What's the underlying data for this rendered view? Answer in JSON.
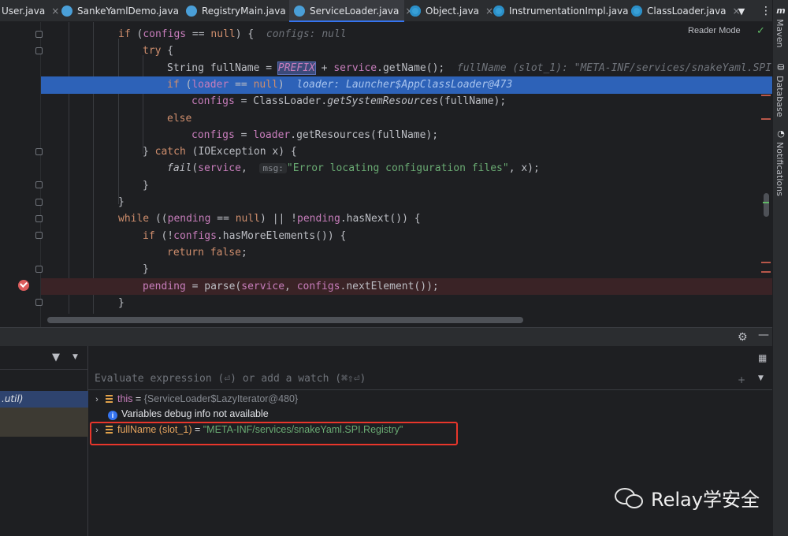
{
  "tabs": [
    {
      "label": "User.java",
      "active": false
    },
    {
      "label": "SankeYamlDemo.java",
      "active": false
    },
    {
      "label": "RegistryMain.java",
      "active": false
    },
    {
      "label": "ServiceLoader.java",
      "active": true
    },
    {
      "label": "Object.java",
      "active": false
    },
    {
      "label": "InstrumentationImpl.java",
      "active": false
    },
    {
      "label": "ClassLoader.java",
      "active": false
    }
  ],
  "tab_close_glyph": "×",
  "editor": {
    "reader_mode_label": "Reader Mode",
    "code": {
      "l1_if": "if",
      "l1_configs": "configs",
      "l1_rest": " == ",
      "l1_null": "null",
      "l1_end": ") {",
      "l1_hint": "configs: null",
      "l2_try": "try",
      "l2_end": " {",
      "l3_type": "String fullName = ",
      "l3_prefix": "PREFIX",
      "l3_plus": " + ",
      "l3_service": "service",
      "l3_dot": ".",
      "l3_getname": "getName",
      "l3_end": "();",
      "l3_hint": "fullName (slot_1): \"META-INF/services/snakeYaml.SPI.",
      "l4_if": "if",
      "l4_open": " (",
      "l4_loader": "loader",
      "l4_eq": " == ",
      "l4_null": "null",
      "l4_close": ")",
      "l4_hint": "loader: Launcher$AppClassLoader@473",
      "l5_configs": "configs",
      "l5_assign": " = ClassLoader.",
      "l5_method": "getSystemResources",
      "l5_end": "(fullName);",
      "l6_else": "else",
      "l7_configs": "configs",
      "l7_assign": " = ",
      "l7_loader": "loader",
      "l7_dot": ".getResources(fullName);",
      "l8_brace": "} ",
      "l8_catch": "catch",
      "l8_end": " (IOException x) {",
      "l9_fail": "fail",
      "l9_open": "(",
      "l9_service": "service",
      "l9_comma": ", ",
      "l9_msg": "msg:",
      "l9_str": "\"Error locating configuration files\"",
      "l9_end": ", x);",
      "l10": "}",
      "l11": "}",
      "l12_while": "while",
      "l12_open": " ((",
      "l12_pending": "pending",
      "l12_eq": " == ",
      "l12_null": "null",
      "l12_or": ") || !",
      "l12_pending2": "pending",
      "l12_end": ".hasNext()) {",
      "l13_if": "if",
      "l13_open": " (!",
      "l13_configs": "configs",
      "l13_end": ".hasMoreElements()) {",
      "l14_return": "return",
      "l14_false": " false",
      "l14_end": ";",
      "l15": "}",
      "l16_pending": "pending",
      "l16_assign": " = parse(",
      "l16_service": "service",
      "l16_comma": ", ",
      "l16_configs": "configs",
      "l16_end": ".nextElement());",
      "l17": "}"
    }
  },
  "tool_windows": {
    "maven": "Maven",
    "maven_glyph": "m",
    "database": "Database",
    "notifications": "Notifications"
  },
  "debugger": {
    "frame_selected": ".util)",
    "eval_placeholder": "Evaluate expression (⏎) or add a watch (⌘⇧⏎)",
    "variables": [
      {
        "name": "this",
        "eq": " = ",
        "value": "{ServiceLoader$LazyIterator@480}"
      },
      {
        "info": "Variables debug info not available"
      },
      {
        "name": "fullName (slot_1)",
        "eq": " = ",
        "value": "\"META-INF/services/snakeYaml.SPI.Registry\""
      }
    ]
  },
  "watermark": "Relay学安全",
  "colors": {
    "highlight_line": "#2d62b8",
    "breakpoint": "#db5c5c",
    "annotation_box": "#e8362b"
  }
}
